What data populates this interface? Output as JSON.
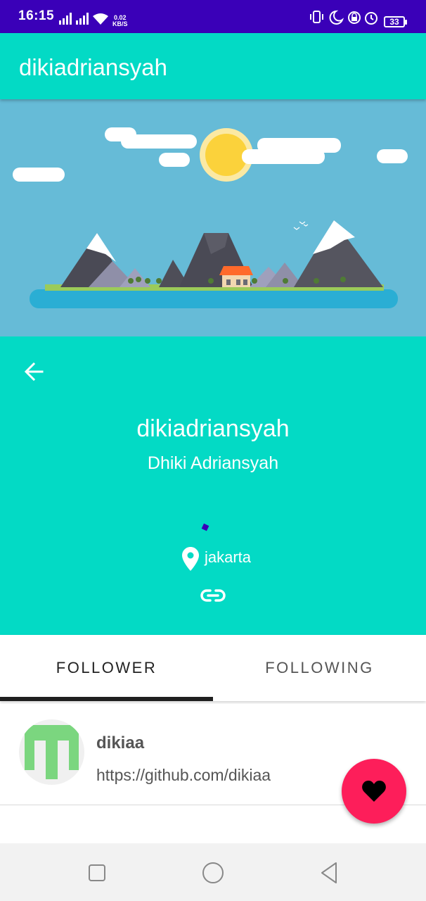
{
  "status_bar": {
    "time": "16:15",
    "network_speed_value": "0.02",
    "network_speed_unit": "KB/S",
    "battery_level": "33"
  },
  "app_bar": {
    "title": "dikiadriansyah"
  },
  "profile": {
    "username": "dikiadriansyah",
    "full_name": "Dhiki Adriansyah",
    "location": "jakarta"
  },
  "tabs": [
    {
      "label": "FOLLOWER",
      "selected": true
    },
    {
      "label": "FOLLOWING",
      "selected": false
    }
  ],
  "followers": [
    {
      "name": "dikiaa",
      "url": "https://github.com/dikiaa"
    }
  ],
  "colors": {
    "status_bar": "#3a00b8",
    "primary": "#03dac5",
    "sky": "#66bbd7",
    "fab": "#fd1e5a"
  },
  "icons": {
    "back": "arrow-left-icon",
    "location": "location-pin-icon",
    "link": "link-icon",
    "favorite": "heart-icon"
  }
}
